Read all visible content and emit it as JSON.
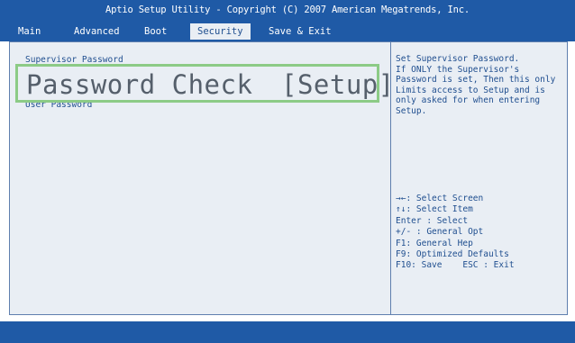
{
  "header": {
    "title": "Aptio Setup Utility - Copyright (C) 2007 American Megatrends, Inc.",
    "tabs": [
      {
        "label": "Main"
      },
      {
        "label": "Advanced"
      },
      {
        "label": "Boot"
      },
      {
        "label": "Security"
      },
      {
        "label": "Save & Exit"
      }
    ],
    "active_tab": "Security"
  },
  "main": {
    "items": [
      {
        "label": "Supervisor Password"
      },
      {
        "label": "User Password"
      }
    ],
    "highlight": {
      "label": "Password Check",
      "value": "[Setup]"
    }
  },
  "help": {
    "description": "Set Supervisor Password.\nIf ONLY the Supervisor's\nPassword is set, Then this only\nLimits access to Setup and is\nonly asked for when entering\nSetup.",
    "keys": "→←: Select Screen\n↑↓: Select Item\nEnter : Select\n+/- : General Opt\nF1: General Hep\nF9: Optimized Defaults\nF10: Save    ESC : Exit"
  },
  "colors": {
    "bar": "#1f5aa6",
    "panel": "#e9eef4",
    "text": "#1f4e8f",
    "highlight_border": "#8ccb86"
  }
}
